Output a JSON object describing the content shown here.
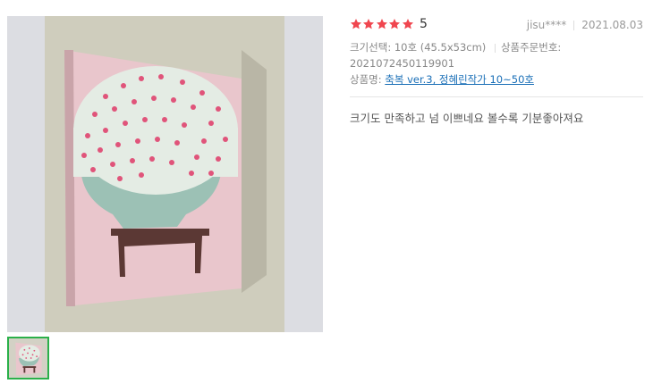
{
  "review": {
    "rating": "5",
    "stars_filled": 5,
    "stars_total": 5,
    "author": "jisu****",
    "date": "2021.08.03",
    "size_label": "크기선택:",
    "size_value": "10호 (45.5x53cm)",
    "order_label": "상품주문번호:",
    "order_number": "2021072450119901",
    "product_label": "상품명:",
    "product_name": "축복 ver.3, 정혜린작가 10~50호",
    "text": "크기도 만족하고 넘 이쁘네요 볼수록 기분좋아져요"
  },
  "colors": {
    "star": "#f0464f",
    "link": "#1a6fb7",
    "thumb_border": "#2bb04a"
  }
}
